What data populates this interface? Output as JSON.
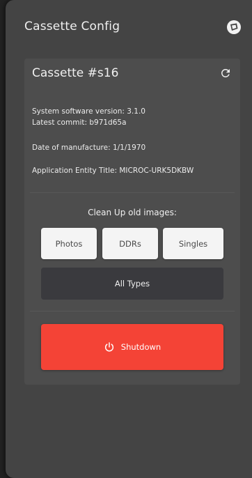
{
  "panel": {
    "title": "Cassette Config",
    "header_icon": "cassette-status-icon"
  },
  "card": {
    "title": "Cassette #s16",
    "refresh_icon": "refresh-icon",
    "info": {
      "software_version": "System software version: 3.1.0",
      "latest_commit": "Latest commit: b971d65a",
      "date_of_manufacture": "Date of manufacture: 1/1/1970",
      "ae_title": "Application Entity Title: MICROC-URK5DKBW"
    },
    "cleanup": {
      "label": "Clean Up old images:",
      "photos_label": "Photos",
      "ddrs_label": "DDRs",
      "singles_label": "Singles",
      "all_types_label": "All Types"
    },
    "shutdown": {
      "label": "Shutdown",
      "icon": "power-icon"
    }
  },
  "colors": {
    "panel_bg": "#444444",
    "card_bg": "#4d4d4d",
    "shutdown_red": "#f44336",
    "dark_button": "#3a3a3e",
    "light_button": "#f4f4f4"
  }
}
